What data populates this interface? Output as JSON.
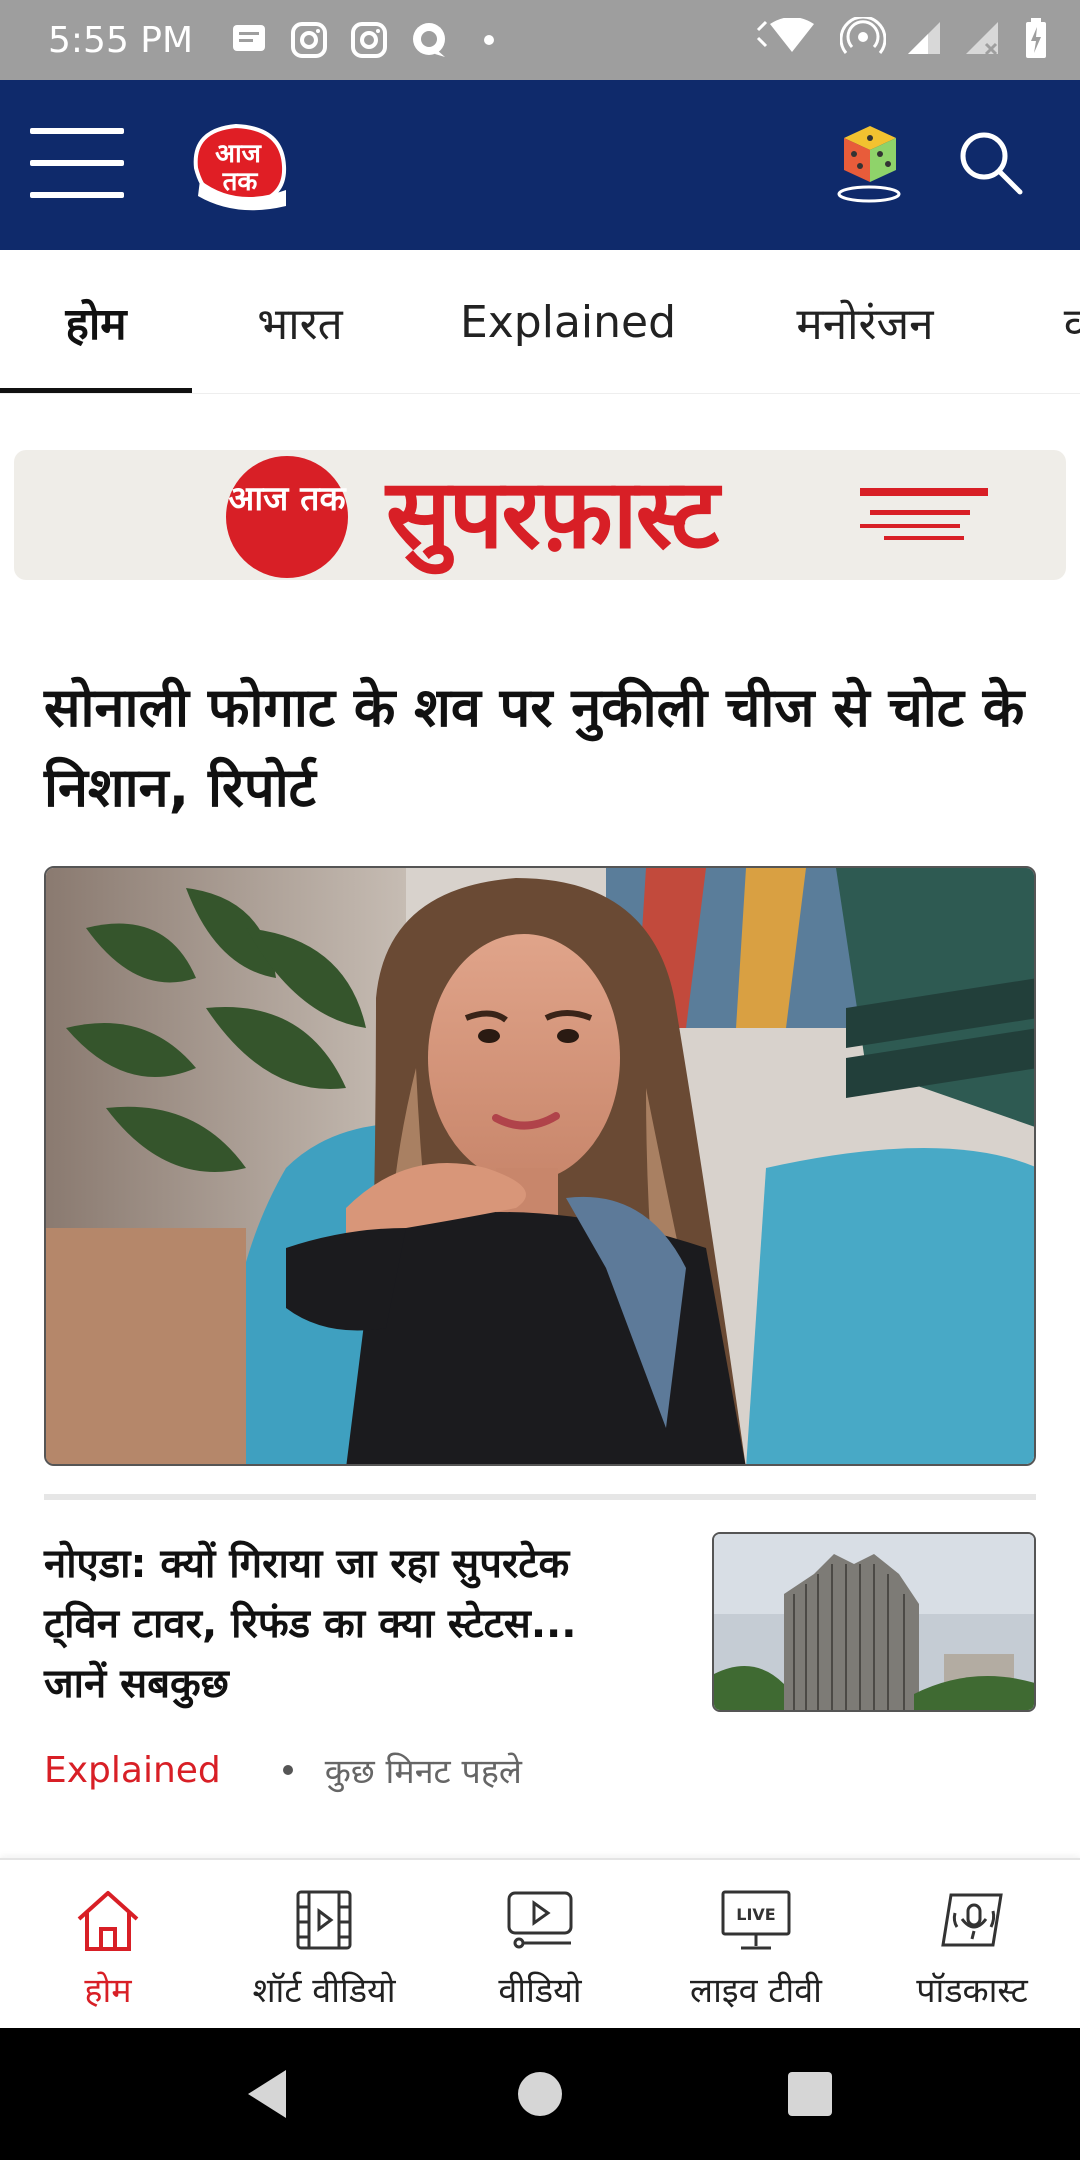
{
  "status_bar": {
    "time": "5:55 PM"
  },
  "header": {
    "logo_text": "आज तक",
    "menu_icon": "hamburger-menu-icon",
    "game_icon": "dice-game-icon",
    "search_icon": "search-icon",
    "background_color": "#0f2a6b"
  },
  "tabs": [
    {
      "label": "होम",
      "active": true
    },
    {
      "label": "भारत",
      "active": false
    },
    {
      "label": "Explained",
      "active": false
    },
    {
      "label": "मनोरंजन",
      "active": false
    }
  ],
  "banner": {
    "logo_text": "आज तक",
    "title": "सुपरफ़ास्ट"
  },
  "top_story": {
    "headline": "सोनाली फोगाट के शव पर नुकीली चीज से चोट के निशान, रिपोर्ट"
  },
  "second_story": {
    "title": "नोएडा: क्यों गिराया जा रहा सुपरटेक ट्विन टावर, रिफंड का क्या स्टेटस... जानें सबकुछ",
    "tag": "Explained",
    "time": "कुछ मिनट पहले"
  },
  "bottom_nav": [
    {
      "label": "होम",
      "icon": "home-icon",
      "active": true
    },
    {
      "label": "शॉर्ट वीडियो",
      "icon": "short-video-icon",
      "active": false
    },
    {
      "label": "वीडियो",
      "icon": "video-icon",
      "active": false
    },
    {
      "label": "लाइव टीवी",
      "icon": "live-tv-icon",
      "active": false,
      "badge": "LIVE"
    },
    {
      "label": "पॉडकास्ट",
      "icon": "podcast-icon",
      "active": false
    }
  ],
  "colors": {
    "accent": "#d81f26",
    "header": "#0f2a6b"
  }
}
